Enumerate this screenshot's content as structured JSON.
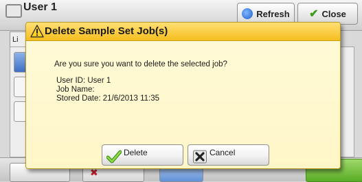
{
  "background": {
    "title": "User 1",
    "refresh_label": "Refresh",
    "close_label": "Close",
    "list_tab_label": "Li"
  },
  "dialog": {
    "title": "Delete Sample Set Job(s)",
    "question": "Are you sure you want to delete the selected job?",
    "user_id": "User ID: User 1",
    "job_name": "Job Name:",
    "stored_date": "Stored Date: 21/6/2013 11:35",
    "delete_label": "Delete",
    "cancel_label": "Cancel"
  },
  "colors": {
    "title_bar": "#f6be1e",
    "dialog_bg": "#fff8cc",
    "delete_icon": "#6bbf2a",
    "cancel_icon": "#333333"
  },
  "icons": {
    "title": "warning-icon",
    "delete": "checkmark-icon",
    "cancel": "x-icon"
  }
}
